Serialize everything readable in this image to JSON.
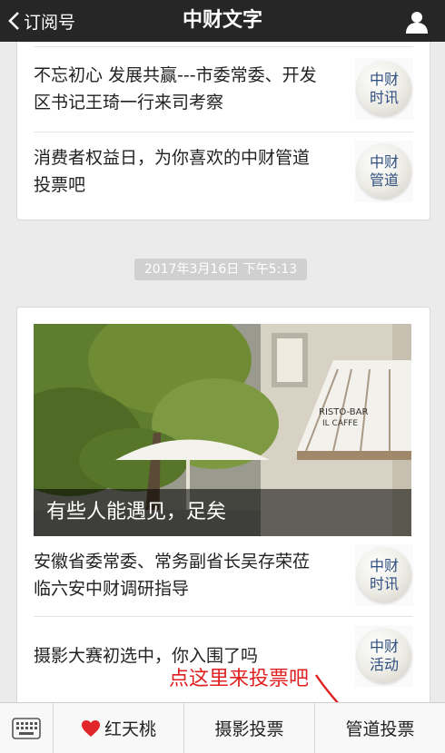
{
  "nav": {
    "back_label": "订阅号",
    "title": "中财文字"
  },
  "card1": {
    "items": [
      {
        "text": "不忘初心  发展共赢---市委常委、开发区书记王琦一行来司考察",
        "thumb": [
          "中财",
          "时讯"
        ]
      },
      {
        "text": "消费者权益日，为你喜欢的中财管道投票吧",
        "thumb": [
          "中财",
          "管道"
        ]
      }
    ]
  },
  "timestamp": "2017年3月16日 下午5:13",
  "card2": {
    "cover_caption": "有些人能遇见，足矣",
    "cover_sign": [
      "RISTO-BAR",
      "IL CAFFE"
    ],
    "items": [
      {
        "text": "安徽省委常委、常务副省长吴存荣莅临六安中财调研指导",
        "thumb": [
          "中财",
          "时讯"
        ]
      },
      {
        "text": "摄影大赛初选中，你入围了吗",
        "thumb": [
          "中财",
          "活动"
        ]
      }
    ]
  },
  "annotation": "点这里来投票吧",
  "bottom_menu": {
    "items": [
      "红天桃",
      "摄影投票",
      "管道投票"
    ]
  },
  "colors": {
    "topbar": "#262626",
    "thumb_text": "#2f4f7f",
    "annotation": "#e02020",
    "heart": "#e0262a"
  },
  "icons": [
    "chevron-left-icon",
    "user-icon",
    "keyboard-icon",
    "heart-icon"
  ]
}
